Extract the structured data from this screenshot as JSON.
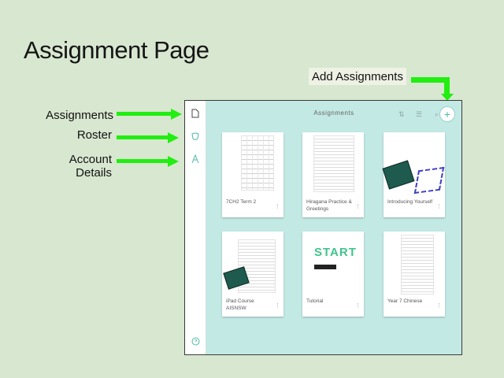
{
  "slide": {
    "title": "Assignment Page",
    "add_assignments_label": "Add Assignments"
  },
  "callouts": {
    "assignments": "Assignments",
    "roster": "Roster",
    "account_details": "Account Details"
  },
  "app": {
    "header_title": "Assignments",
    "add_button_symbol": "+",
    "cards": [
      {
        "label": "7CH2 Term 2"
      },
      {
        "label": "Hiragana Practice & Greetings"
      },
      {
        "label": "Introducing Yourself"
      },
      {
        "label": "iPad Course AISNSW"
      },
      {
        "label": "Tutorial",
        "thumbnail_text": "START"
      },
      {
        "label": "Year 7 Chinese"
      }
    ]
  },
  "colors": {
    "background": "#d8e7d0",
    "arrow": "#22ee11",
    "screen": "#c3e9e5",
    "accent": "#4db8a8"
  },
  "icons": {
    "assignments": "document-icon",
    "roster": "roster-icon",
    "account": "account-icon",
    "help": "help-icon",
    "sort": "sort-icon",
    "list": "list-icon",
    "search": "search-icon",
    "add": "plus-icon",
    "card_menu": "kebab-menu-icon"
  }
}
